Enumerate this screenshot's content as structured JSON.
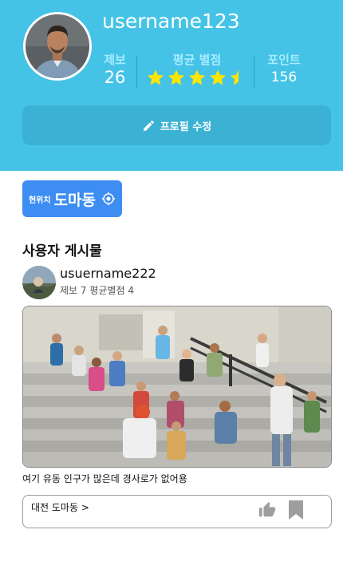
{
  "profile": {
    "username": "username123",
    "stats": {
      "reports_label": "제보",
      "reports_value": "26",
      "rating_label": "평균 별점",
      "rating_value": 4.5,
      "points_label": "포인트",
      "points_value": "156"
    },
    "edit_button_label": "프로필 수정"
  },
  "location": {
    "prefix": "현위치",
    "name": "도마동",
    "icon": "target-icon"
  },
  "posts_section": {
    "title": "사용자 게시물"
  },
  "post": {
    "username": "usuername222",
    "meta": "제보 7 평균별점 4",
    "text": "여기 유동 인구가 많은데 경사로가 없어용",
    "location_link": "대전 도마동 >",
    "icons": [
      "thumbs-up-icon",
      "bookmark-icon"
    ]
  },
  "colors": {
    "header_bg": "#45c3e6",
    "star": "#ffe600",
    "location_button": "#3d8df3",
    "icon_gray": "#9e9e9e"
  }
}
